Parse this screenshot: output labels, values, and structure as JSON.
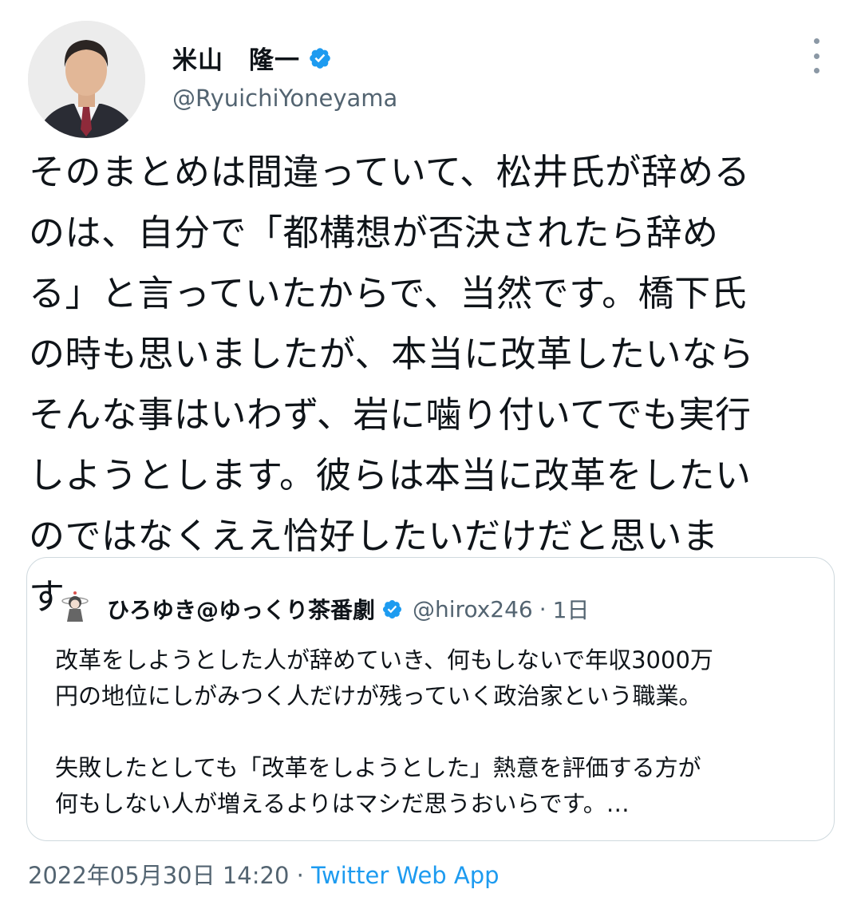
{
  "author": {
    "name": "米山　隆一",
    "handle": "@RyuichiYoneyama"
  },
  "tweet": {
    "text": "そのまとめは間違っていて、松井氏が辞める\nのは、自分で「都構想が否決されたら辞め\nる」と言っていたからで、当然です。橋下氏\nの時も思いましたが、本当に改革したいなら\nそんな事はいわず、岩に噛り付いてでも実行\nしようとします。彼らは本当に改革をしたい\nのではなくええ恰好したいだけだと思いま\nす。"
  },
  "quote": {
    "name": "ひろゆき@ゆっくり茶番劇",
    "handle": "@hirox246",
    "separator": "·",
    "time": "1日",
    "text": "改革をしようとした人が辞めていき、何もしないで年収3000万\n円の地位にしがみつく人だけが残っていく政治家という職業。\n\n失敗したとしても「改革をしようとした」熱意を評価する方が\n何もしない人が増えるよりはマシだ思うおいらです。…"
  },
  "meta": {
    "timestamp": "2022年05月30日 14:20",
    "separator": " · ",
    "source": "Twitter Web App"
  },
  "icons": {
    "verified": "verified-badge-icon",
    "more": "more-vertical-icon"
  },
  "colors": {
    "verified": "#1d9bf0",
    "link": "#1d9bf0",
    "secondary_text": "#536471",
    "border": "#cfd9de"
  }
}
